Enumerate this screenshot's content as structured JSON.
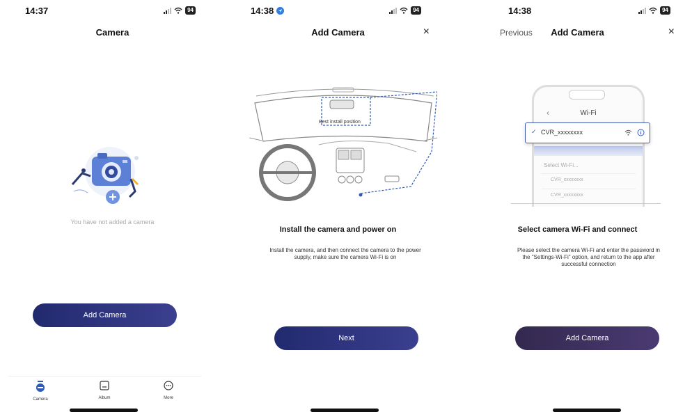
{
  "screen1": {
    "status_time": "14:37",
    "battery": "94",
    "title": "Camera",
    "empty_text": "You have not added a camera",
    "button_label": "Add Camera",
    "tabs": [
      {
        "label": "Camera",
        "icon": "camera-tab-icon"
      },
      {
        "label": "Album",
        "icon": "album-icon"
      },
      {
        "label": "More",
        "icon": "more-icon"
      }
    ]
  },
  "screen2": {
    "status_time": "14:38",
    "battery": "94",
    "title": "Add Camera",
    "close_label": "×",
    "diagram_label": "Best install position",
    "heading": "Install the camera and power on",
    "description": "Install the camera, and then connect the camera to the power supply, make sure the camera Wi-Fi is on",
    "button_label": "Next"
  },
  "screen3": {
    "status_time": "14:38",
    "battery": "94",
    "previous_label": "Previous",
    "title": "Add Camera",
    "close_label": "×",
    "wifi_screen_title": "Wi-Fi",
    "wifi_selected": "CVR_xxxxxxxx",
    "wifi_select_label": "Select Wi-Fi...",
    "wifi_list": [
      "CVR_xxxxxxxx",
      "CVR_xxxxxxxx"
    ],
    "heading": "Select camera Wi-Fi and connect",
    "description": "Please select the camera Wi-Fi and enter the password in the \"Settings-Wi-Fi\" option, and return to the app after successful connection",
    "button_label": "Add Camera"
  },
  "colors": {
    "primary_button": "#2b3178",
    "secondary_button": "#3e2f5c",
    "accent_blue": "#2f5bb5"
  }
}
